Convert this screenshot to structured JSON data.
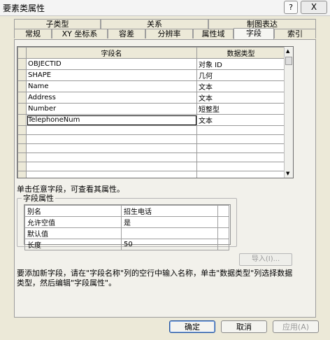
{
  "window": {
    "title": "要素类属性",
    "help_label": "?",
    "close_label": "X"
  },
  "tabs_top": [
    {
      "label": "子类型"
    },
    {
      "label": "关系"
    },
    {
      "label": "制图表达"
    }
  ],
  "tabs_bottom": [
    {
      "label": "常规"
    },
    {
      "label": "XY 坐标系"
    },
    {
      "label": "容差"
    },
    {
      "label": "分辨率"
    },
    {
      "label": "属性域"
    },
    {
      "label": "字段",
      "active": true
    },
    {
      "label": "索引"
    }
  ],
  "fields_grid": {
    "columns": [
      "字段名",
      "数据类型"
    ],
    "rows": [
      {
        "name": "OBJECTID",
        "type": "对象 ID"
      },
      {
        "name": "SHAPE",
        "type": "几何"
      },
      {
        "name": "Name",
        "type": "文本"
      },
      {
        "name": "Address",
        "type": "文本"
      },
      {
        "name": "Number",
        "type": "短整型"
      },
      {
        "name": "TelephoneNum",
        "type": "文本"
      }
    ]
  },
  "hint_select": "单击任意字段，可查看其属性。",
  "field_properties": {
    "group_title": "字段属性",
    "rows": [
      {
        "label": "别名",
        "value": "招生电话"
      },
      {
        "label": "允许空值",
        "value": "是"
      },
      {
        "label": "默认值",
        "value": ""
      },
      {
        "label": "长度",
        "value": "50"
      }
    ]
  },
  "import_label": "导入(I)...",
  "hint_add": "要添加新字段，请在\"字段名称\"列的空行中输入名称，单击\"数据类型\"列选择数据类型，然后编辑\"字段属性\"。",
  "buttons": {
    "ok": "确定",
    "cancel": "取消",
    "apply": "应用(A)"
  }
}
